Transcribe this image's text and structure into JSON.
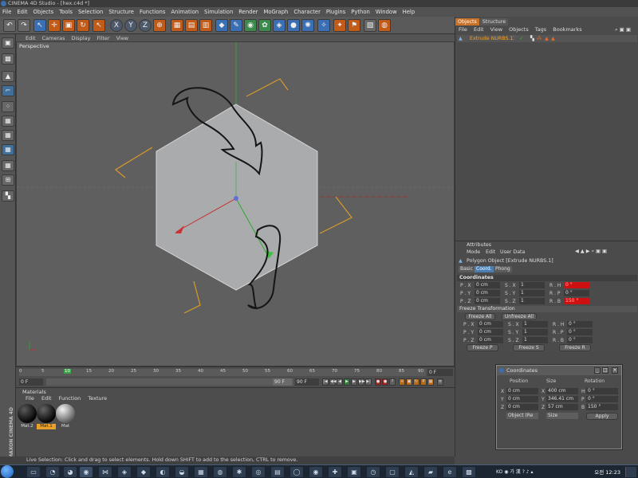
{
  "window": {
    "title": "CINEMA 4D Studio - [hex.c4d *]"
  },
  "menus": [
    "File",
    "Edit",
    "Objects",
    "Tools",
    "Selection",
    "Structure",
    "Functions",
    "Animation",
    "Simulation",
    "Render",
    "MoGraph",
    "Character",
    "Plugins",
    "Python",
    "Window",
    "Help"
  ],
  "toolbar": {
    "icons": [
      {
        "name": "undo-icon",
        "glyph": "↶"
      },
      {
        "name": "redo-icon",
        "glyph": "↷"
      },
      {
        "name": "live-selection-icon",
        "glyph": "↖"
      },
      {
        "name": "move-icon",
        "glyph": "✛"
      },
      {
        "name": "scale-icon",
        "glyph": "▣"
      },
      {
        "name": "rotate-icon",
        "glyph": "↻"
      },
      {
        "name": "last-tool-icon",
        "glyph": "↖"
      },
      {
        "name": "x-axis-icon",
        "glyph": "X"
      },
      {
        "name": "y-axis-icon",
        "glyph": "Y"
      },
      {
        "name": "z-axis-icon",
        "glyph": "Z"
      },
      {
        "name": "coordinate-system-icon",
        "glyph": "⊕"
      },
      {
        "name": "render-view-icon",
        "glyph": "▦"
      },
      {
        "name": "render-picture-viewer-icon",
        "glyph": "▤"
      },
      {
        "name": "edit-render-settings-icon",
        "glyph": "▥"
      },
      {
        "name": "cube-icon",
        "glyph": "◆"
      },
      {
        "name": "spline-pen-icon",
        "glyph": "✎"
      },
      {
        "name": "nurbs-icon",
        "glyph": "◉"
      },
      {
        "name": "array-icon",
        "glyph": "✿"
      },
      {
        "name": "deformer-icon",
        "glyph": "◈"
      },
      {
        "name": "scene-icon",
        "glyph": "●"
      },
      {
        "name": "environment-icon",
        "glyph": "✺"
      },
      {
        "name": "camera-icon",
        "glyph": "✧"
      },
      {
        "name": "light-icon",
        "glyph": "✦"
      },
      {
        "name": "tag-icon",
        "glyph": "⚑"
      },
      {
        "name": "script-icon",
        "glyph": "▧"
      },
      {
        "name": "python-icon",
        "glyph": "◍"
      }
    ]
  },
  "left_tools": [
    {
      "name": "make-editable-icon",
      "glyph": "▣"
    },
    {
      "name": "model-mode-icon",
      "glyph": "▩"
    },
    {
      "name": "object-mode-icon",
      "glyph": "▲"
    },
    {
      "name": "workplane-icon",
      "glyph": "⌐"
    },
    {
      "name": "points-mode-icon",
      "glyph": "⁘"
    },
    {
      "name": "edges-mode-icon",
      "glyph": "▦"
    },
    {
      "name": "polygons-mode-icon",
      "glyph": "▦"
    },
    {
      "name": "uvw-icon",
      "glyph": "▦"
    },
    {
      "name": "axis-mode-icon",
      "glyph": "▦"
    },
    {
      "name": "snap-icon",
      "glyph": "⊞"
    },
    {
      "name": "checker-icon",
      "glyph": "▚"
    },
    {
      "name": "paint-icon",
      "glyph": "✸"
    }
  ],
  "viewport": {
    "menu": [
      "Edit",
      "Cameras",
      "Display",
      "Filter",
      "View"
    ],
    "label": "Perspective"
  },
  "timeline": {
    "ticks": [
      "0",
      "5",
      "10",
      "15",
      "20",
      "25",
      "30",
      "35",
      "40",
      "45",
      "50",
      "55",
      "60",
      "65",
      "70",
      "75",
      "80",
      "85",
      "90"
    ],
    "current_frame": "0 F",
    "start_frame": "0 F",
    "end_frame": "90 F",
    "max_frame": "90 F",
    "range_end": "90 F"
  },
  "materials": {
    "title": "Materials",
    "menu": [
      "File",
      "Edit",
      "Function",
      "Texture"
    ],
    "items": [
      {
        "label": "Mat.2",
        "color1": "#4a4a4a",
        "color2": "#070707"
      },
      {
        "label": "Mat.1",
        "color1": "#555555",
        "color2": "#0a0a0a",
        "selected": true
      },
      {
        "label": "Mat",
        "color1": "#e8e8e8",
        "color2": "#606060"
      }
    ],
    "brand": "MAXON CINEMA 4D"
  },
  "status": "Live Selection: Click and drag to select elements. Hold down SHIFT to add to the selection, CTRL to remove.",
  "objects": {
    "tabs": [
      "Objects",
      "Structure"
    ],
    "menu": [
      "File",
      "Edit",
      "View",
      "Objects",
      "Tags",
      "Bookmarks"
    ],
    "row": "Extrude NURBS.1"
  },
  "attributes": {
    "title": "Attributes",
    "menu": [
      "Mode",
      "Edit",
      "User Data"
    ],
    "object": "Polygon Object [Extrude NURBS.1]",
    "tabs": [
      "Basic",
      "Coord.",
      "Phong"
    ],
    "section": "Coordinates",
    "freeze_section": "Freeze Transformation",
    "freeze_all": "Freeze All",
    "unfreeze_all": "Unfreeze All",
    "freeze_p": "Freeze P",
    "freeze_s": "Freeze S",
    "freeze_r": "Freeze R",
    "rows": [
      {
        "p": "P . X",
        "pv": "0 cm",
        "s": "S . X",
        "sv": "1",
        "r": "R . H",
        "rv": "0 °"
      },
      {
        "p": "P . Y",
        "pv": "0 cm",
        "s": "S . Y",
        "sv": "1",
        "r": "R . P",
        "rv": "0 °"
      },
      {
        "p": "P . Z",
        "pv": "0 cm",
        "s": "S . Z",
        "sv": "1",
        "r": "R . B",
        "rv": "150 °"
      }
    ],
    "freeze_rows": [
      {
        "p": "P . X",
        "pv": "0 cm",
        "s": "S . X",
        "sv": "1",
        "r": "R . H",
        "rv": "0 °"
      },
      {
        "p": "P . Y",
        "pv": "0 cm",
        "s": "S . Y",
        "sv": "1",
        "r": "R . P",
        "rv": "0 °"
      },
      {
        "p": "P . Z",
        "pv": "0 cm",
        "s": "S . Z",
        "sv": "1",
        "r": "R . B",
        "rv": "0 °"
      }
    ]
  },
  "coord_window": {
    "title": "Coordinates",
    "headers": [
      "Position",
      "Size",
      "Rotation"
    ],
    "rows": [
      {
        "pa": "X",
        "pv": "0 cm",
        "sa": "X",
        "sv": "400 cm",
        "ra": "H",
        "rv": "0 °"
      },
      {
        "pa": "Y",
        "pv": "0 cm",
        "sa": "Y",
        "sv": "346.41 cm",
        "ra": "P",
        "rv": "0 °"
      },
      {
        "pa": "Z",
        "pv": "0 cm",
        "sa": "Z",
        "sv": "57 cm",
        "ra": "B",
        "rv": "150 °"
      }
    ],
    "mode_select": "Object (Re",
    "size_select": "Size",
    "apply": "Apply"
  },
  "taskbar": {
    "clock": "오전 12:23",
    "tray": "KO ◉ 가 漢 ? ♪ ▴"
  }
}
